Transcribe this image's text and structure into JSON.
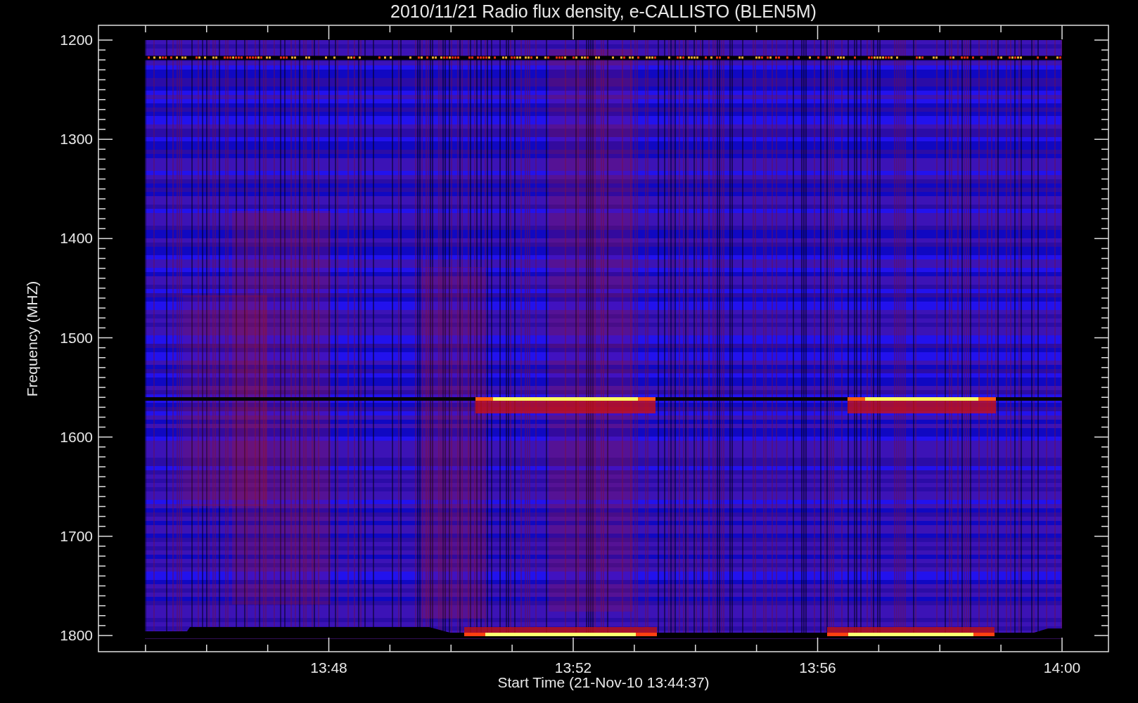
{
  "plot": {
    "title": "2010/11/21  Radio flux density, e-CALLISTO (BLEN5M)",
    "ylabel": "Frequency (MHZ)",
    "xlabel": "Start Time (21-Nov-10 13:44:37)",
    "yticks": [
      "1200",
      "1300",
      "1400",
      "1500",
      "1600",
      "1700",
      "1800"
    ],
    "xticks": [
      "13:48",
      "13:52",
      "13:56",
      "14:00"
    ]
  }
}
